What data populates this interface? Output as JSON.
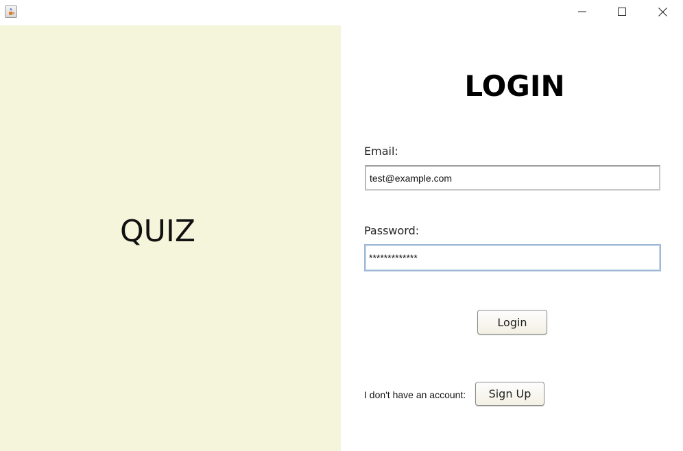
{
  "window": {
    "app_icon": "java-cup-icon",
    "controls": {
      "minimize": "minimize-icon",
      "maximize": "maximize-icon",
      "close": "close-icon"
    }
  },
  "left_panel": {
    "title": "QUIZ",
    "background": "#f5f5dc"
  },
  "login_form": {
    "heading": "LOGIN",
    "email_label": "Email:",
    "email_value": "test@example.com",
    "password_label": "Password:",
    "password_value": "*************",
    "login_button": "Login",
    "no_account_text": "I don't have an account:",
    "signup_button": "Sign Up"
  }
}
